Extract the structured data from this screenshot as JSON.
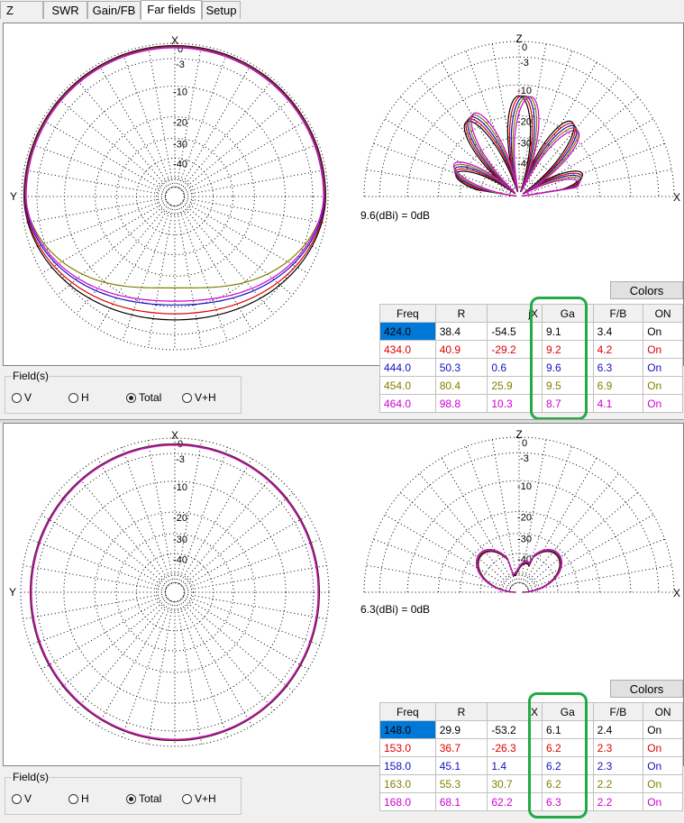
{
  "tabs": [
    "Z",
    "SWR",
    "Gain/FB",
    "Far fields",
    "Setup"
  ],
  "active_tab": "Far fields",
  "panels": [
    {
      "gain_label": "9.6(dBi) = 0dB",
      "colors_label": "Colors",
      "fields_label": "Field(s)",
      "radios": [
        {
          "label": "V",
          "checked": false
        },
        {
          "label": "H",
          "checked": false
        },
        {
          "label": "Total",
          "checked": true
        },
        {
          "label": "V+H",
          "checked": false
        }
      ],
      "polar_axis": {
        "top": "X",
        "left": "Y",
        "ring_labels": [
          "0",
          "-3",
          "-10",
          "-20",
          "-30",
          "-40"
        ]
      },
      "elev_axis": {
        "top": "Z",
        "right": "X",
        "ring_labels": [
          "0",
          "-3",
          "-10",
          "-20",
          "-30",
          "-40"
        ]
      },
      "headers": [
        "Freq",
        "R",
        "jX",
        "Ga",
        "F/B",
        "ON"
      ],
      "rows": [
        {
          "freq": "424.0",
          "r": "38.4",
          "jx": "-54.5",
          "ga": "9.1",
          "fb": "3.4",
          "on": "On",
          "color": "#000000"
        },
        {
          "freq": "434.0",
          "r": "40.9",
          "jx": "-29.2",
          "ga": "9.2",
          "fb": "4.2",
          "on": "On",
          "color": "#e00000"
        },
        {
          "freq": "444.0",
          "r": "50.3",
          "jx": "0.6",
          "ga": "9.6",
          "fb": "6.3",
          "on": "On",
          "color": "#1010c0"
        },
        {
          "freq": "454.0",
          "r": "80.4",
          "jx": "25.9",
          "ga": "9.5",
          "fb": "6.9",
          "on": "On",
          "color": "#808000"
        },
        {
          "freq": "464.0",
          "r": "98.8",
          "jx": "10.3",
          "ga": "8.7",
          "fb": "4.1",
          "on": "On",
          "color": "#d000d0"
        }
      ]
    },
    {
      "gain_label": "6.3(dBi) = 0dB",
      "colors_label": "Colors",
      "fields_label": "Field(s)",
      "radios": [
        {
          "label": "V",
          "checked": false
        },
        {
          "label": "H",
          "checked": false
        },
        {
          "label": "Total",
          "checked": true
        },
        {
          "label": "V+H",
          "checked": false
        }
      ],
      "polar_axis": {
        "top": "X",
        "left": "Y",
        "ring_labels": [
          "0",
          "-3",
          "-10",
          "-20",
          "-30",
          "-40"
        ]
      },
      "elev_axis": {
        "top": "Z",
        "right": "X",
        "ring_labels": [
          "0",
          "-3",
          "-10",
          "-20",
          "-30",
          "-40"
        ]
      },
      "headers": [
        "Freq",
        "R",
        "jX",
        "Ga",
        "F/B",
        "ON"
      ],
      "rows": [
        {
          "freq": "148.0",
          "r": "29.9",
          "jx": "-53.2",
          "ga": "6.1",
          "fb": "2.4",
          "on": "On",
          "color": "#000000"
        },
        {
          "freq": "153.0",
          "r": "36.7",
          "jx": "-26.3",
          "ga": "6.2",
          "fb": "2.3",
          "on": "On",
          "color": "#e00000"
        },
        {
          "freq": "158.0",
          "r": "45.1",
          "jx": "1.4",
          "ga": "6.2",
          "fb": "2.3",
          "on": "On",
          "color": "#1010c0"
        },
        {
          "freq": "163.0",
          "r": "55.3",
          "jx": "30.7",
          "ga": "6.2",
          "fb": "2.2",
          "on": "On",
          "color": "#808000"
        },
        {
          "freq": "168.0",
          "r": "68.1",
          "jx": "62.2",
          "ga": "6.3",
          "fb": "2.2",
          "on": "On",
          "color": "#d000d0"
        }
      ]
    }
  ]
}
